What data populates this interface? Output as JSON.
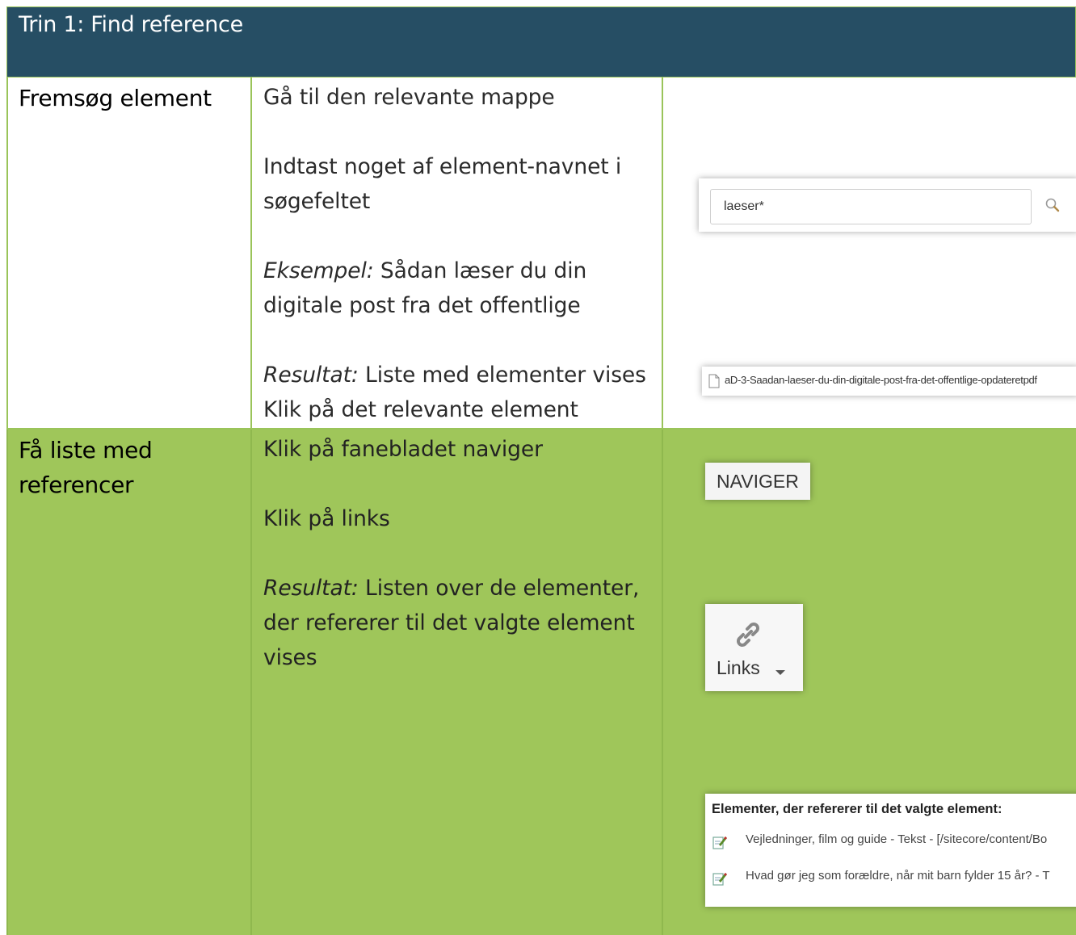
{
  "header": {
    "title": "Trin 1: Find reference"
  },
  "rows": [
    {
      "label": "Fremsøg element",
      "instructions": {
        "line1": "Gå til den relevante mappe",
        "line2": "Indtast noget af element-navnet i søgefeltet",
        "example_prefix": "Eksempel:",
        "example_text": " Sådan læser du din digitale post fra det offentlige",
        "result_prefix": "Resultat:",
        "result_text": " Liste med elementer vises",
        "line_last": "Klik på det relevante element"
      },
      "search": {
        "value": "laeser*",
        "icon": "search-icon"
      },
      "result_item": {
        "label": "aD-3-Saadan-laeser-du-din-digitale-post-fra-det-offentlige-opdateretpdf",
        "icon": "file-icon"
      }
    },
    {
      "label": "Få liste med referencer",
      "instructions": {
        "line1": "Klik på fanebladet naviger",
        "line2": "Klik på links",
        "result_prefix": "Resultat:",
        "result_text": "  Listen over de elementer, der refererer til det valgte element vises"
      },
      "nav_tab": {
        "label": "NAVIGER"
      },
      "links_button": {
        "label": "Links",
        "icon": "link-icon"
      },
      "references": {
        "title": "Elementer, der refererer til det valgte element:",
        "items": [
          "Vejledninger, film og guide - Tekst - [/sitecore/content/Bo",
          "Hvad gør jeg som forældre, når mit barn fylder 15 år? - T"
        ]
      }
    }
  ],
  "colors": {
    "header_bg": "#264e64",
    "green_row": "#9fc65a",
    "border": "#9ac45a"
  }
}
